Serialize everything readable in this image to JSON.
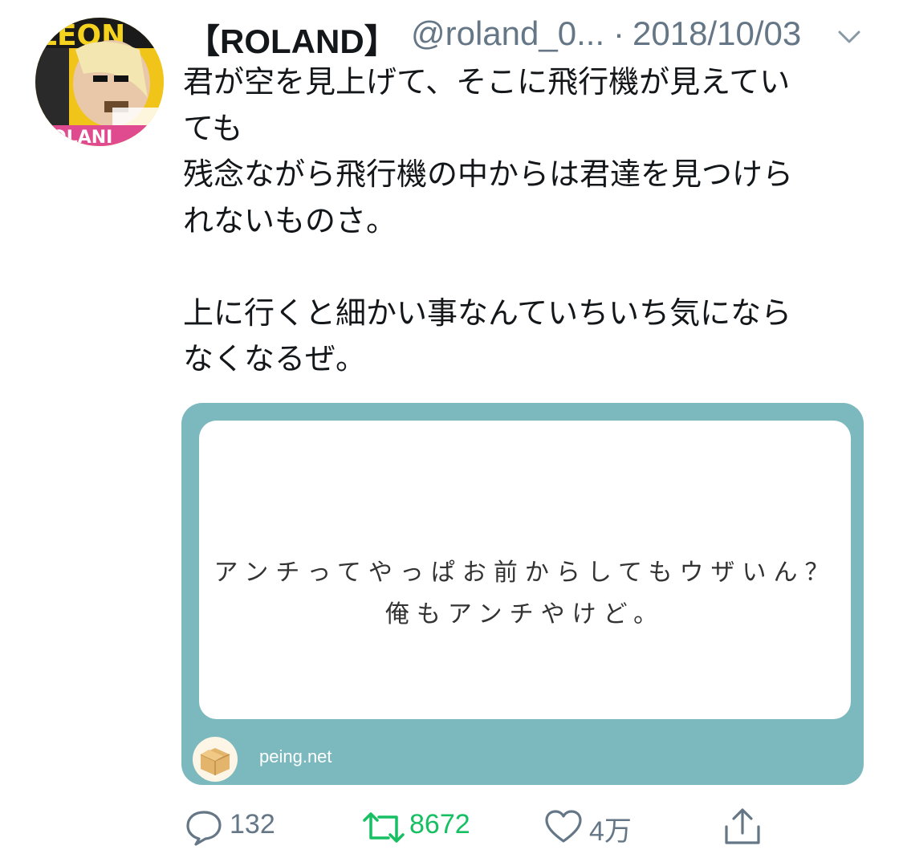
{
  "tweet": {
    "display_name": "【ROLAND】",
    "handle": "@roland_0...",
    "separator": "·",
    "date": "2018/10/03",
    "text_lines": [
      "君が空を見上げて、そこに飛行機が見えてい",
      "ても",
      "残念ながら飛行機の中からは君達を見つけら",
      "れないものさ。",
      "",
      "上に行くと細かい事なんていちいち気になら",
      "なくなるぜ。"
    ]
  },
  "card": {
    "question_lines": [
      "アンチってやっぱお前からしてもウザいん？",
      "俺もアンチやけど。"
    ],
    "domain": "peing.net",
    "icon": "box-icon"
  },
  "actions": {
    "reply_count": "132",
    "retweet_count": "8672",
    "like_count": "4万",
    "icons": [
      "reply-icon",
      "retweet-icon",
      "like-icon",
      "share-icon"
    ]
  },
  "colors": {
    "text": "#14171a",
    "muted": "#657786",
    "retweet_active": "#17bf63",
    "card_frame": "#7bb9be"
  }
}
